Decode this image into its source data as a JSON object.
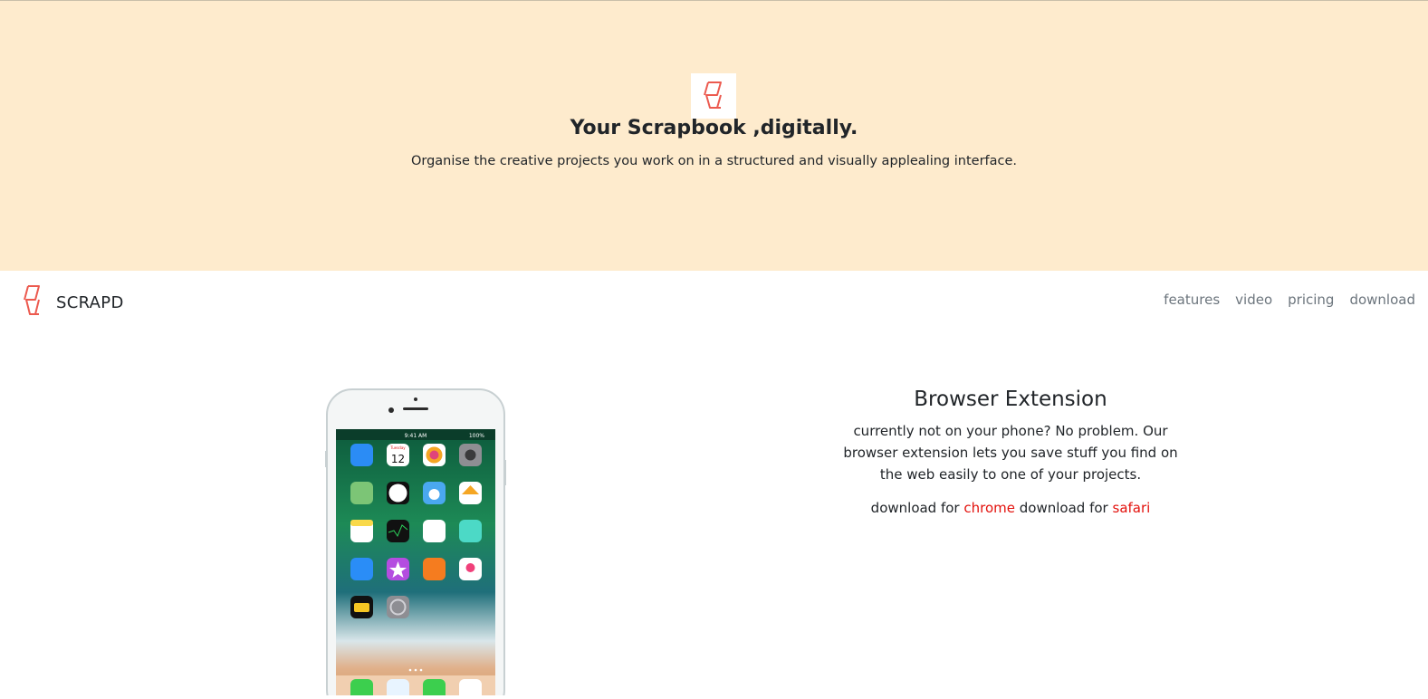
{
  "hero": {
    "title": "Your Scrapbook ,digitally.",
    "subtitle": "Organise the creative projects you work on in a structured and visually applealing interface."
  },
  "nav": {
    "brand": "SCRAPD",
    "links": [
      "features",
      "video",
      "pricing",
      "download"
    ]
  },
  "extension": {
    "title": "Browser Extension",
    "description": "currently not on your phone? No problem. Our browser extension lets you save stuff you find on the web easily to one of your projects.",
    "download_prefix": "download for",
    "chrome_label": "chrome",
    "safari_label": "safari"
  },
  "phone": {
    "status_time": "9:41 AM",
    "status_battery": "100%",
    "calendar_day": "Tuesday",
    "calendar_date": "12",
    "apps": [
      "Mail",
      "Calendar",
      "Photos",
      "Camera",
      "Maps",
      "Clock",
      "Weather",
      "Home",
      "Notes",
      "Stocks",
      "Reminders",
      "Videos",
      "App Store",
      "iTunes Store",
      "iBooks",
      "Health",
      "Wallet",
      "Settings"
    ]
  },
  "colors": {
    "hero_bg": "#feebcd",
    "accent": "#e3110c",
    "logo": "#ec5a4f",
    "nav_link": "#6c757d"
  }
}
